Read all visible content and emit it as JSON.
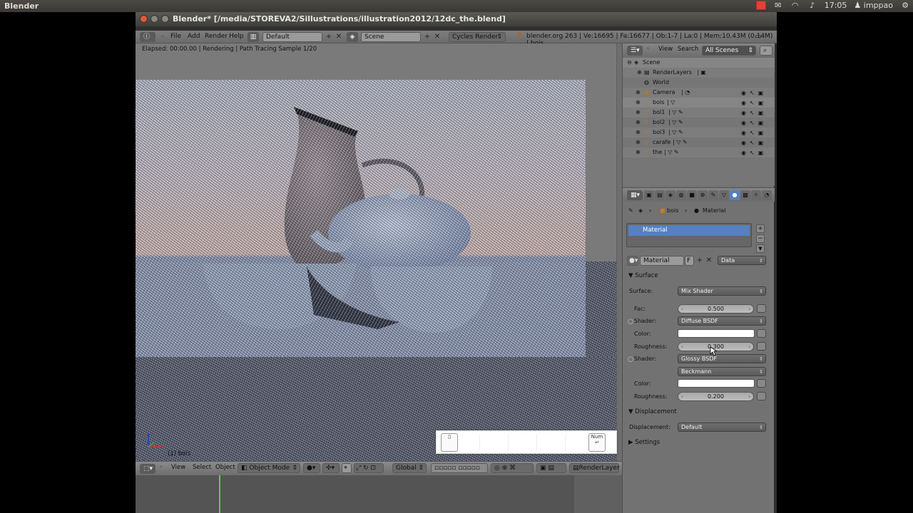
{
  "system_bar": {
    "app_name": "Blender",
    "clock": "17:05",
    "user": "imppao"
  },
  "window": {
    "title": "Blender* [/media/STOREVA2/Sillustrations/illustration2012/12dc_the.blend]"
  },
  "info_header": {
    "menus": [
      "File",
      "Add",
      "Render",
      "Help"
    ],
    "screen_layout": "Default",
    "scene": "Scene",
    "render_engine": "Cycles Render",
    "stats": "blender.org 263 | Ve:16695 | Fa:16677 | Ob:1-7 | La:0 | Mem:10.43M (0.14M) | bois"
  },
  "viewport": {
    "status": "Elapsed: 00:00.00 | Rendering | Path Tracing Sample 1/20",
    "object_label": "(1) bois",
    "key_overlay_num": "Num"
  },
  "view3d_header": {
    "menus": [
      "View",
      "Select",
      "Object"
    ],
    "mode": "Object Mode",
    "orientation": "Global",
    "layer": "RenderLayer"
  },
  "outliner": {
    "menus": [
      "View",
      "Search"
    ],
    "filter": "All Scenes",
    "items": [
      {
        "label": "Scene",
        "indent": 0
      },
      {
        "label": "RenderLayers",
        "indent": 1
      },
      {
        "label": "World",
        "indent": 1
      },
      {
        "label": "Camera",
        "indent": 1
      },
      {
        "label": "bois",
        "indent": 1
      },
      {
        "label": "bol1",
        "indent": 1
      },
      {
        "label": "bol2",
        "indent": 1
      },
      {
        "label": "bol3",
        "indent": 1
      },
      {
        "label": "carafe",
        "indent": 1
      },
      {
        "label": "the",
        "indent": 1
      }
    ]
  },
  "properties": {
    "breadcrumb": [
      "bois",
      "Material"
    ],
    "material_slot": "Material",
    "material_name": "Material",
    "fake_user": "F",
    "link": "Data",
    "sections": {
      "surface": "Surface",
      "displacement": "Displacement",
      "settings": "Settings"
    },
    "surface": {
      "label": "Surface:",
      "value": "Mix Shader",
      "fac_label": "Fac:",
      "fac": "0.500",
      "shader1_label": "Shader:",
      "shader1": "Diffuse BSDF",
      "color1_label": "Color:",
      "rough1_label": "Roughness:",
      "rough1": "0.300",
      "shader2_label": "Shader:",
      "shader2": "Glossy BSDF",
      "distribution": "Beckmann",
      "color2_label": "Color:",
      "rough2_label": "Roughness:",
      "rough2": "0.200"
    },
    "displacement": {
      "label": "Displacement:",
      "value": "Default"
    }
  }
}
